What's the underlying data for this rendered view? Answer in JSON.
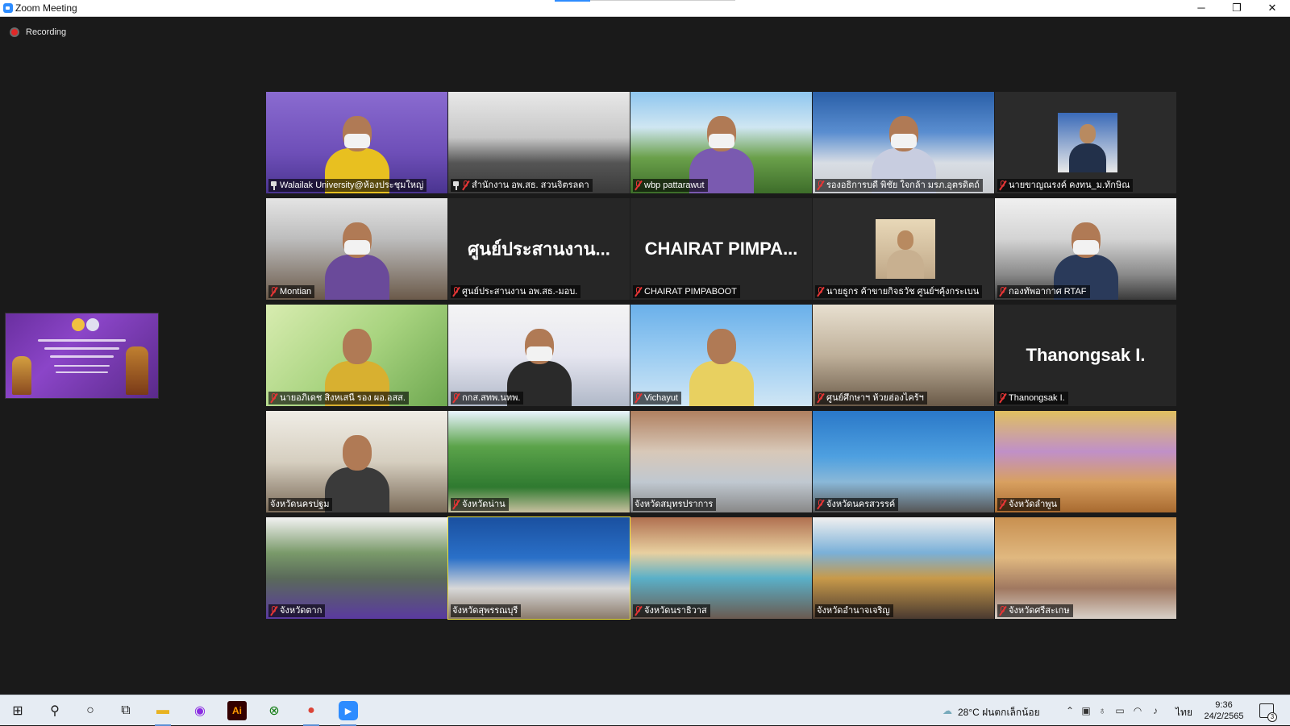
{
  "window": {
    "title": "Zoom Meeting",
    "minimize_label": "─",
    "restore_label": "❐",
    "close_label": "✕"
  },
  "recording": {
    "label": "Recording"
  },
  "tiles": [
    {
      "label": "Walailak University@ห้องประชุมใหญ่",
      "type": "video",
      "muted": false,
      "pinned": true,
      "scene": "purple"
    },
    {
      "label": "สำนักงาน อพ.สธ. สวนจิตรลดา",
      "type": "video",
      "muted": true,
      "pinned": true,
      "scene": "room"
    },
    {
      "label": "wbp pattarawut",
      "type": "video",
      "muted": true,
      "scene": "outdoor"
    },
    {
      "label": "รองอธิการบดี พิชัย ใจกล้า มรภ.อุตรดิตถ์",
      "type": "video",
      "muted": true,
      "scene": "blue"
    },
    {
      "label": "นายขาญณรงค์ คงทน_ม.ทักษิณ",
      "type": "photo",
      "muted": true,
      "scene": "photo-dark"
    },
    {
      "label": "Montian",
      "type": "video",
      "muted": true,
      "scene": "office"
    },
    {
      "label": "ศูนย์ประสานงาน อพ.สธ.-มอบ.",
      "type": "name",
      "name_text": "ศูนย์ประสานงาน...",
      "muted": true
    },
    {
      "label": "CHAIRAT PIMPABOOT",
      "type": "name",
      "name_text": "CHAIRAT  PIMPA...",
      "muted": true
    },
    {
      "label": "นายธูกร ค้าขายกิจธวัช ศูนย์ฯคุ้งกระเบน",
      "type": "photo",
      "muted": true,
      "scene": "photo-light"
    },
    {
      "label": "กองทัพอากาศ RTAF",
      "type": "video",
      "muted": true,
      "scene": "ceiling"
    },
    {
      "label": "นายอภิเดช สิงหเสนี รอง ผอ.อสส.",
      "type": "video",
      "muted": true,
      "scene": "green"
    },
    {
      "label": "กกส.สทพ.นทพ.",
      "type": "video",
      "muted": true,
      "scene": "banner"
    },
    {
      "label": "Vichayut",
      "type": "video",
      "muted": true,
      "scene": "lightblue"
    },
    {
      "label": "ศูนย์ศึกษาฯ ห้วยฮ่องไคร้ฯ",
      "type": "video",
      "muted": true,
      "scene": "shelves"
    },
    {
      "label": "Thanongsak I.",
      "type": "name",
      "name_text": "Thanongsak I.",
      "muted": true
    },
    {
      "label": "จังหวัดนครปฐม",
      "type": "video",
      "muted": false,
      "scene": "office2"
    },
    {
      "label": "จังหวัดน่าน",
      "type": "video",
      "muted": true,
      "scene": "nan"
    },
    {
      "label": "จังหวัดสมุทรปราการ",
      "type": "video",
      "muted": false,
      "scene": "hall"
    },
    {
      "label": "จังหวัดนครสวรรค์",
      "type": "video",
      "muted": true,
      "scene": "dragon"
    },
    {
      "label": "จังหวัดลำพูน",
      "type": "video",
      "muted": true,
      "scene": "lamphun"
    },
    {
      "label": "จังหวัดตาก",
      "type": "video",
      "muted": true,
      "scene": "tak"
    },
    {
      "label": "จังหวัดสุพรรณบุรี",
      "type": "video",
      "muted": false,
      "scene": "suphan",
      "active": true
    },
    {
      "label": "จังหวัดนราธิวาส",
      "type": "video",
      "muted": true,
      "scene": "narathiwat"
    },
    {
      "label": "จังหวัดอำนาจเจริญ",
      "type": "video",
      "muted": false,
      "scene": "amnat"
    },
    {
      "label": "จังหวัดศรีสะเกษ",
      "type": "video",
      "muted": true,
      "scene": "sisaket"
    }
  ],
  "taskbar": {
    "icons": [
      {
        "name": "windows-start-icon",
        "glyph": "⊞",
        "color": "#1a1a1a"
      },
      {
        "name": "search-icon",
        "glyph": "⚲",
        "color": "#1a1a1a"
      },
      {
        "name": "cortana-icon",
        "glyph": "○",
        "color": "#1a1a1a"
      },
      {
        "name": "task-view-icon",
        "glyph": "⧉",
        "color": "#1a1a1a"
      },
      {
        "name": "file-explorer-icon",
        "glyph": "▬",
        "color": "#e8b321"
      },
      {
        "name": "screen-recorder-icon",
        "glyph": "◉",
        "color": "#8a2be2"
      },
      {
        "name": "illustrator-icon",
        "glyph": "Ai",
        "color": "#ff9a00"
      },
      {
        "name": "xbox-icon",
        "glyph": "⊗",
        "color": "#107c10"
      },
      {
        "name": "chrome-icon",
        "glyph": "●",
        "color": "#db4437"
      },
      {
        "name": "zoom-taskbar-icon",
        "glyph": "▶",
        "color": "#2d8cff"
      }
    ],
    "weather": "28°C  ฝนตกเล็กน้อย",
    "language": "ไทย",
    "time": "9:36",
    "date": "24/2/2565",
    "notification_count": "3"
  }
}
